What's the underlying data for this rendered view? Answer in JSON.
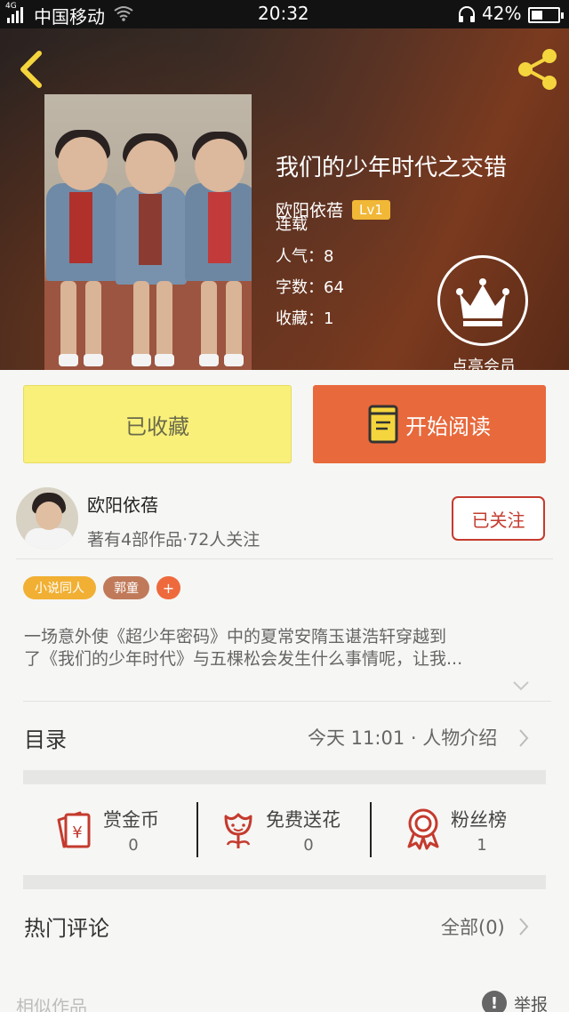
{
  "status_bar": {
    "network": "4G",
    "carrier": "中国移动",
    "time": "20:32",
    "battery": "42%",
    "battery_level": 0.42
  },
  "book": {
    "title": "我们的少年时代之交错",
    "author": "欧阳依蓓",
    "level": "Lv1",
    "status": "连载",
    "popularity": "人气：8",
    "word_count": "字数：64",
    "favorites": "收藏：1",
    "member_label": "点亮会员"
  },
  "actions": {
    "collected": "已收藏",
    "start_reading": "开始阅读"
  },
  "author_card": {
    "name": "欧阳依蓓",
    "stats": "著有4部作品·72人关注",
    "follow": "已关注"
  },
  "tags": [
    {
      "label": "小说同人",
      "color": "#f1b034"
    },
    {
      "label": "郭童",
      "color": "#c07a5a"
    },
    {
      "label": "+",
      "color": "#ee6a3c"
    }
  ],
  "description": {
    "line1": "一场意外使《超少年密码》中的夏常安隋玉谌浩轩穿越到",
    "line2": "了《我们的少年时代》与五棵松会发生什么事情呢，让我..."
  },
  "catalog": {
    "label": "目录",
    "latest": "今天 11:01 · 人物介绍"
  },
  "features": [
    {
      "label": "赏金币",
      "count": "0",
      "icon": "red-envelope-yuan-icon"
    },
    {
      "label": "免费送花",
      "count": "0",
      "icon": "flower-icon"
    },
    {
      "label": "粉丝榜",
      "count": "1",
      "icon": "award-ribbon-icon"
    }
  ],
  "comments": {
    "label": "热门评论",
    "all": "全部(0)"
  },
  "footer": {
    "similar": "相似作品",
    "report": "举报"
  },
  "colors": {
    "accent_orange": "#e8693c",
    "collected_yellow": "#f9f07a",
    "follow_red": "#c43b2e",
    "icon_yellow": "#f5d53d"
  }
}
